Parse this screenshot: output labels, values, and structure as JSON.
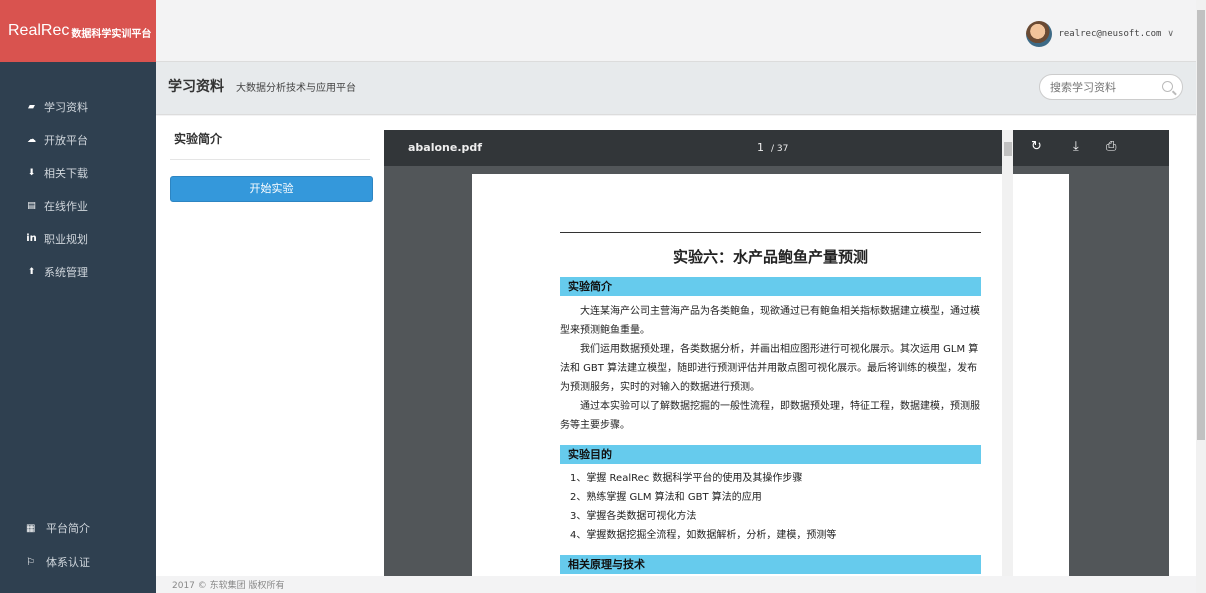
{
  "brand": {
    "main": "RealRec",
    "sub": "数据科学实训平台"
  },
  "nav": [
    {
      "label": "学习资料",
      "icon": "book-icon",
      "glyph": "▰"
    },
    {
      "label": "开放平台",
      "icon": "cloud-icon",
      "glyph": "☁"
    },
    {
      "label": "相关下载",
      "icon": "cloud-download-icon",
      "glyph": "⬇"
    },
    {
      "label": "在线作业",
      "icon": "newspaper-icon",
      "glyph": "▤"
    },
    {
      "label": "职业规划",
      "icon": "linkedin-icon",
      "glyph": "in"
    },
    {
      "label": "系统管理",
      "icon": "arrow-up-icon",
      "glyph": "⬆"
    }
  ],
  "nav_bottom": [
    {
      "label": "平台简介",
      "icon": "film-icon",
      "glyph": "▦"
    },
    {
      "label": "体系认证",
      "icon": "flag-icon",
      "glyph": "⚐"
    }
  ],
  "user": {
    "email": "realrec@neusoft.com"
  },
  "header": {
    "title": "学习资料",
    "subtitle": "大数据分析技术与应用平台"
  },
  "search": {
    "placeholder": "搜索学习资料"
  },
  "left_panel": {
    "title": "实验简介",
    "button": "开始实验"
  },
  "viewer": {
    "filename": "abalone.pdf",
    "page": "1",
    "total": "/ 37"
  },
  "doc": {
    "title": "实验六：水产品鲍鱼产量预测",
    "sec1": "实验简介",
    "p1": "大连某海产公司主营海产品为各类鲍鱼，现欲通过已有鲍鱼相关指标数据建立模型，通过模型来预测鲍鱼重量。",
    "p2": "我们运用数据预处理，各类数据分析，并画出相应图形进行可视化展示。其次运用 GLM 算法和 GBT 算法建立模型，随即进行预测评估并用散点图可视化展示。最后将训练的模型，发布为预测服务，实时的对输入的数据进行预测。",
    "p3": "通过本实验可以了解数据挖掘的一般性流程，即数据预处理，特征工程，数据建模，预测服务等主要步骤。",
    "sec2": "实验目的",
    "goals": [
      "1、掌握 RealRec 数据科学平台的使用及其操作步骤",
      "2、熟练掌握 GLM 算法和 GBT 算法的应用",
      "3、掌握各类数据可视化方法",
      "4、掌握数据挖掘全流程，如数据解析，分析，建模，预测等"
    ],
    "sec3": "相关原理与技术"
  },
  "footer": "2017 © 东软集团 版权所有"
}
